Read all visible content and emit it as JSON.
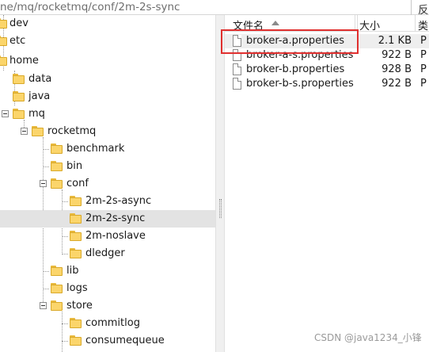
{
  "path_bar": {
    "path": "ne/mq/rocketmq/conf/2m-2s-sync",
    "right_glyph": "反"
  },
  "tree": {
    "items": [
      {
        "id": "dev",
        "label": "dev"
      },
      {
        "id": "etc",
        "label": "etc"
      },
      {
        "id": "home",
        "label": "home"
      },
      {
        "id": "data",
        "label": "data"
      },
      {
        "id": "java",
        "label": "java"
      },
      {
        "id": "mq",
        "label": "mq"
      },
      {
        "id": "rocketmq",
        "label": "rocketmq"
      },
      {
        "id": "benchmark",
        "label": "benchmark"
      },
      {
        "id": "bin",
        "label": "bin"
      },
      {
        "id": "conf",
        "label": "conf"
      },
      {
        "id": "2m-2s-async",
        "label": "2m-2s-async"
      },
      {
        "id": "2m-2s-sync",
        "label": "2m-2s-sync",
        "selected": true
      },
      {
        "id": "2m-noslave",
        "label": "2m-noslave"
      },
      {
        "id": "dledger",
        "label": "dledger"
      },
      {
        "id": "lib",
        "label": "lib"
      },
      {
        "id": "logs",
        "label": "logs"
      },
      {
        "id": "store",
        "label": "store"
      },
      {
        "id": "commitlog",
        "label": "commitlog"
      },
      {
        "id": "consumequeue",
        "label": "consumequeue"
      }
    ]
  },
  "file_list": {
    "columns": {
      "name": "文件名",
      "size": "大小",
      "type": "类"
    },
    "sort": "ascending",
    "files": [
      {
        "name": "broker-a.properties",
        "size": "2.1 KB",
        "type": "P"
      },
      {
        "name": "broker-a-s.properties",
        "size": "922 B",
        "type": "P"
      },
      {
        "name": "broker-b.properties",
        "size": "928 B",
        "type": "P"
      },
      {
        "name": "broker-b-s.properties",
        "size": "922 B",
        "type": "P"
      }
    ]
  },
  "highlight_color": "#e0302f",
  "watermark": "CSDN @java1234_小锋"
}
